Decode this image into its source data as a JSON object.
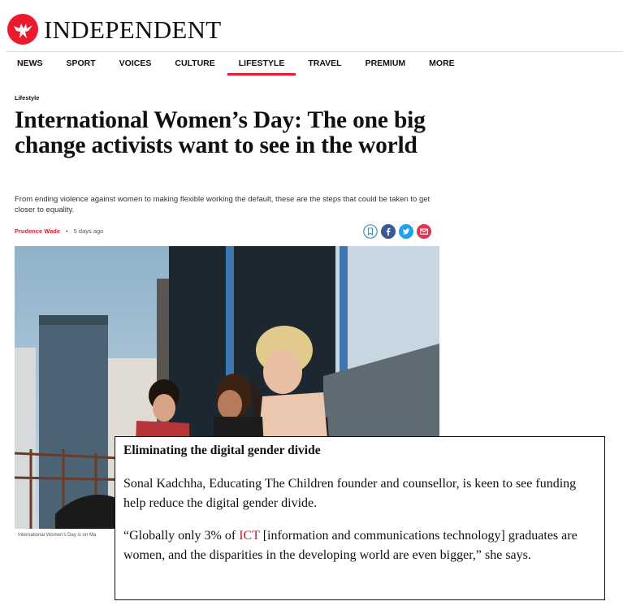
{
  "brand": {
    "name": "INDEPENDENT",
    "logo_icon": "eagle-icon",
    "accent": "#ec1a2e"
  },
  "nav": {
    "items": [
      "NEWS",
      "SPORT",
      "VOICES",
      "CULTURE",
      "LIFESTYLE",
      "TRAVEL",
      "PREMIUM",
      "MORE"
    ],
    "active": "LIFESTYLE"
  },
  "article": {
    "section": "Lifestyle",
    "headline": "International Women’s Day: The one big change activists want to see in the world",
    "standfirst": "From ending violence against women to making flexible working the default, these are the steps that could be taken to get closer to equality.",
    "author": "Prudence Wade",
    "separator": "•",
    "time": "5 days ago",
    "share_icons": [
      "bookmark-icon",
      "facebook-icon",
      "twitter-icon",
      "email-icon"
    ],
    "image_caption": "International Women’s Day is on Ma"
  },
  "callout": {
    "title": "Eliminating the digital gender divide",
    "p1": "Sonal Kadchha, Educating The Children founder and counsellor, is keen to see funding help reduce the digital gender divide.",
    "p2_before": "“Globally only 3% of ",
    "p2_highlight": "ICT",
    "p2_after": " [information and communications technology] graduates are women, and the disparities in the developing world are even bigger,” she says."
  }
}
